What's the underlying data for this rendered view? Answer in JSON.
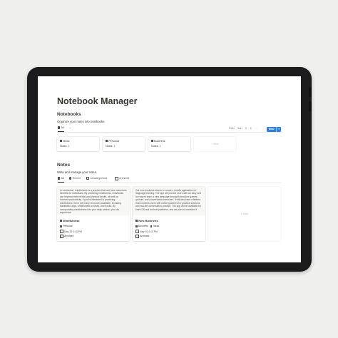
{
  "page": {
    "title": "Notebook Manager"
  },
  "notebooks": {
    "heading": "Notebooks",
    "description": "Organize your notes into notebooks.",
    "view_tab": "All",
    "view_more": "⌄",
    "tools": {
      "filter": "Filter",
      "sort": "Sort",
      "search_icon": "search-icon",
      "automation_icon": "lightning-icon",
      "more": "…"
    },
    "new_button": "New",
    "cards": [
      {
        "title": "Ideas",
        "count": "Notes: 1"
      },
      {
        "title": "Personal",
        "count": "Notes: 1"
      },
      {
        "title": "Business",
        "count": "Notes: 1"
      }
    ],
    "new_card": "+ New"
  },
  "notes": {
    "heading": "Notes",
    "description": "Write and manage your notes.",
    "tabs": [
      "All",
      "Recent",
      "Uncategorized",
      "Archived"
    ],
    "cards": [
      {
        "preview": "In conclusion, mindfulness is a practice that can have numerous benefits for individuals. By practicing mindfulness, individuals can improve their mental and physical health, as well as increase productivity. If you're interested in practicing mindfulness, there are many resources available, including meditation apps, mindfulness courses, and books. By incorporating mindfulness into your daily routine, you can experience",
        "title": "Mindfulness",
        "tags": [
          "Personal"
        ],
        "date": "May 26 4:43 PM",
        "archived_label": "Archived"
      },
      {
        "preview": "Our new business idea is to create a mobile application for language learning. The app will provide users with an easy and fun way to learn a new language through interactive games, quizzes, and conversation exercises. It will also have a feature that connects users with native speakers for practice sessions and real-life conversation practice. The app will be available for both iOS and Android platforms, and we plan to monetize it",
        "title": "New Business",
        "tags": [
          "Business",
          "Ideas"
        ],
        "date": "May 26 4:41 PM",
        "archived_label": "Archived"
      }
    ],
    "new_card": "+ New"
  },
  "colors": {
    "accent": "#2f80d8",
    "device": "#1b1b1d",
    "background": "#f0f0ee"
  }
}
